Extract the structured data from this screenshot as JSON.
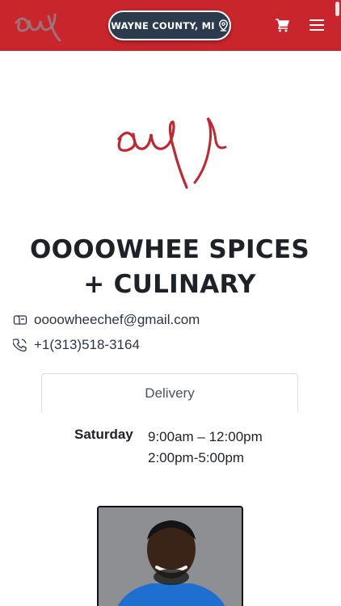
{
  "header": {
    "location_label": "WAYNE COUNTY, MI",
    "logo_icon": "ooowhee-script-logo",
    "cart_icon": "cart-icon",
    "menu_icon": "hamburger-menu-icon",
    "bar_color": "#c8262c"
  },
  "business": {
    "name": "OOOOWHEE SPICES + CULINARY",
    "email": "oooowheechef@gmail.com",
    "phone": "+1(313)518-3164"
  },
  "tabs": [
    {
      "label": "Delivery"
    }
  ],
  "hours": [
    {
      "day": "Saturday",
      "times": [
        "9:00am – 12:00pm",
        "2:00pm-5:00pm"
      ]
    }
  ],
  "colors": {
    "brand_red": "#c8262c",
    "pill_bg": "#2b3a4d"
  }
}
